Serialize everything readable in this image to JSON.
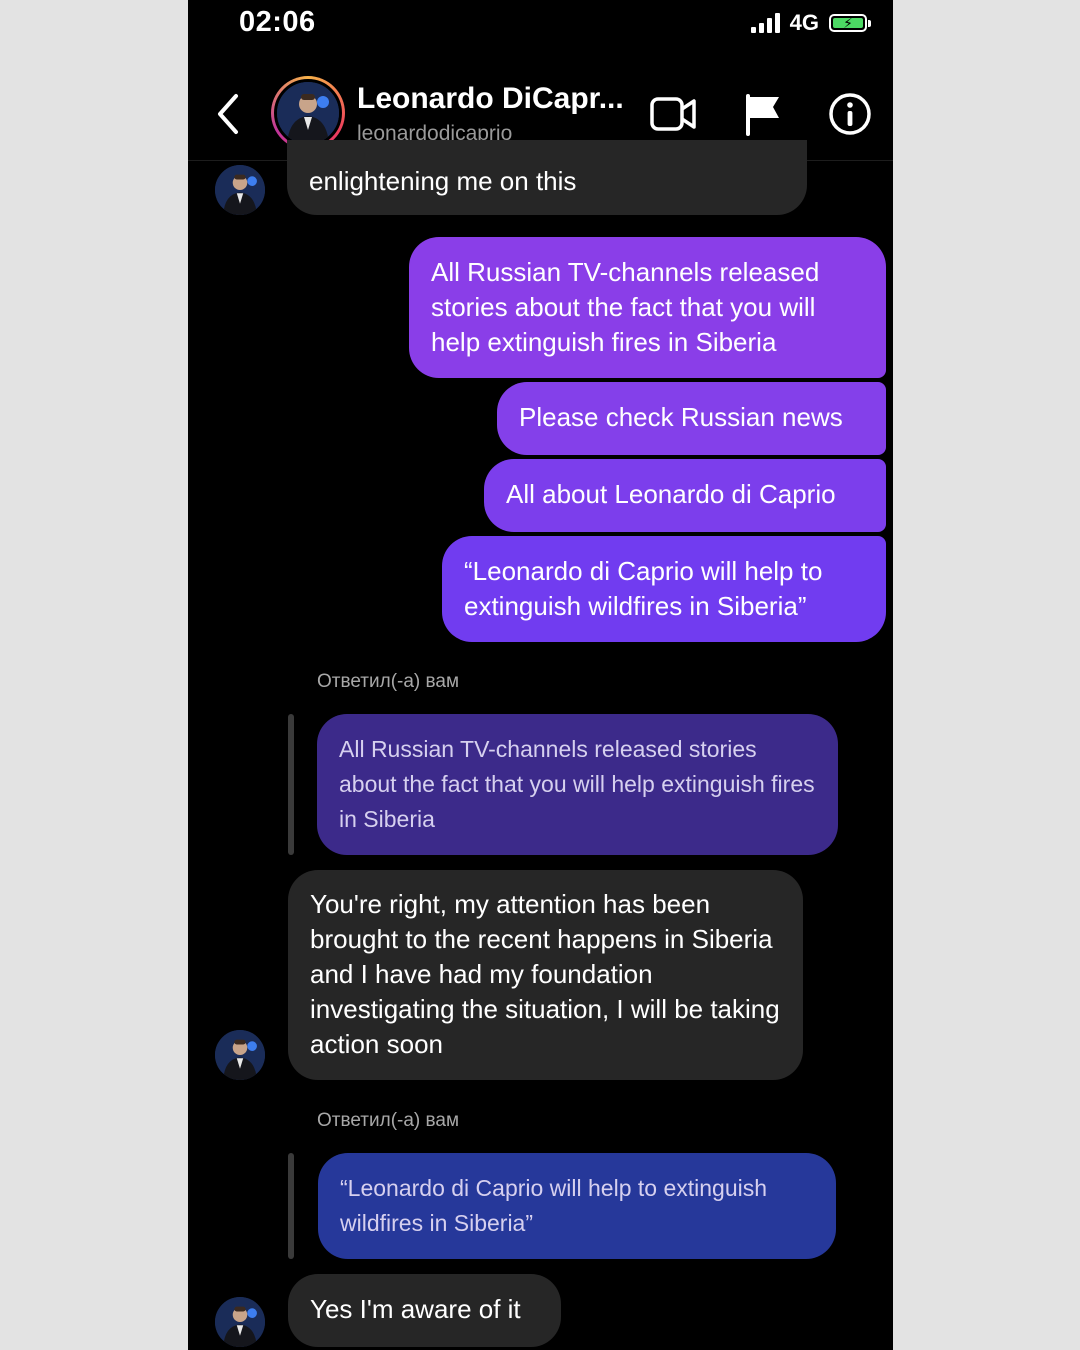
{
  "status": {
    "time": "02:06",
    "network": "4G"
  },
  "header": {
    "name": "Leonardo DiCapr...",
    "handle": "leonardodicaprio"
  },
  "icons": {
    "back": "chevron-left-icon",
    "video": "video-call-icon",
    "flag": "flag-icon",
    "info": "info-icon"
  },
  "colors": {
    "background": "#000000",
    "received_bubble": "#262626",
    "sent_bubble_top": "#8a3ee8",
    "sent_bubble_bottom": "#6d3cf0",
    "quote_purple": "#3c2a8a",
    "quote_blue": "#26389a",
    "story_ring": "#ee3d5c"
  },
  "messages": {
    "m1": "enlightening me on this",
    "m2": "All Russian TV-channels released stories about the fact that you will help extinguish fires in Siberia",
    "m3": "Please check Russian news",
    "m4": "All about Leonardo di Caprio",
    "m5": "“Leonardo di Caprio will help to extinguish wildfires in Siberia”",
    "reply1_label": "Ответил(-а) вам",
    "reply1_quote": "All Russian TV-channels released stories about the fact that you will help extinguish fires in Siberia",
    "m6": "You're right, my attention has been brought to the recent happens in Siberia and I have had my foundation investigating the situation, I will be taking action soon",
    "reply2_label": "Ответил(-а) вам",
    "reply2_quote": "“Leonardo di Caprio will help to extinguish wildfires in Siberia”",
    "m7": "Yes I'm aware of it"
  }
}
